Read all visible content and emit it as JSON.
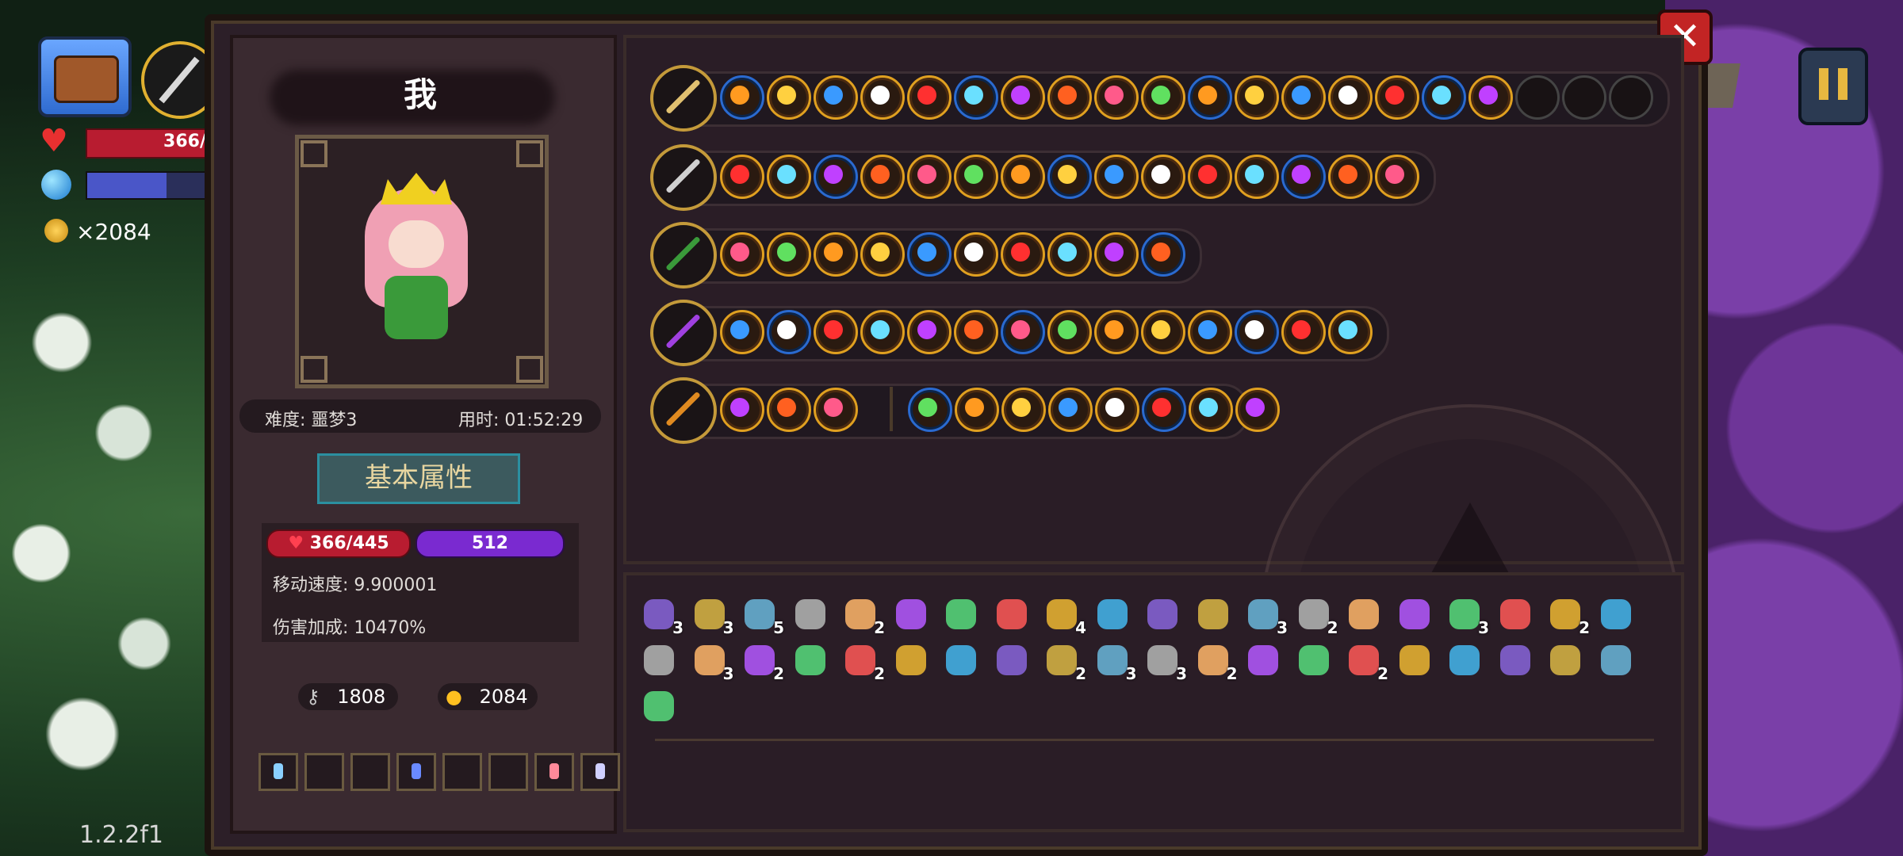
{
  "hud": {
    "hp_text": "366/",
    "gold_text": "×2084",
    "version": "1.2.2f1"
  },
  "character": {
    "name": "我",
    "difficulty": "难度: 噩梦3",
    "time": "用时: 01:52:29"
  },
  "attributes": {
    "title": "基本属性",
    "hp": "366/445",
    "mana": "512",
    "move_speed": "移动速度: 9.900001",
    "damage_bonus": "伤害加成: 10470%",
    "keys": "1808",
    "gold": "2084"
  },
  "wand_rows": [
    {
      "spell_count": 17,
      "empty_slots": 3
    },
    {
      "spell_count": 15,
      "empty_slots": 0
    },
    {
      "spell_count": 10,
      "empty_slots": 0
    },
    {
      "spell_count": 14,
      "empty_slots": 0
    },
    {
      "spell_count": 11,
      "empty_slots": 0
    }
  ],
  "inventory_counts": {
    "row1": [
      "3",
      "3",
      "5",
      "",
      "2",
      "",
      "",
      "",
      "4",
      "",
      "",
      "",
      "3",
      "2",
      "",
      "",
      "3",
      "",
      "2",
      ""
    ],
    "row2": [
      "",
      "3",
      "2",
      "",
      "2",
      "",
      "",
      "",
      "2",
      "3",
      "3",
      "2",
      "",
      "",
      "2",
      "",
      "",
      "",
      "",
      ""
    ],
    "row3": [
      ""
    ]
  },
  "colors": {
    "panel": "#2c1f28",
    "gold_border": "#e0a020",
    "blue_border": "#2a6ad0",
    "hp_red": "#b81c30",
    "mana_purple": "#7a2ad0"
  }
}
